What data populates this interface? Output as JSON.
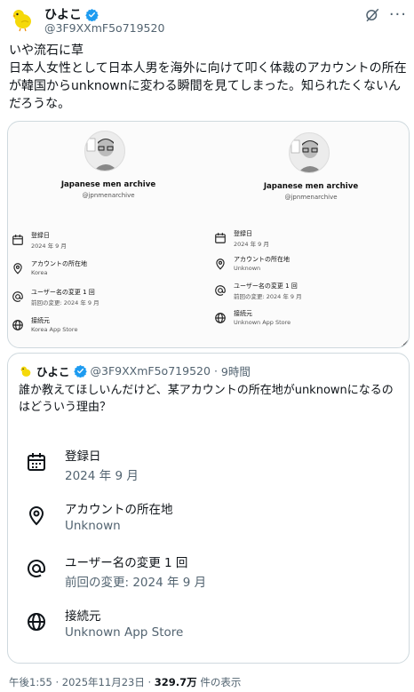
{
  "author": {
    "display_name": "ひよこ",
    "handle": "@3F9XXmF5o719520"
  },
  "tweet": {
    "text": "いや流石に草\n日本人女性として日本人男を海外に向けて叩く体裁のアカウントの所在が韓国からunknownに変わる瞬間を見てしまった。知られたくないんだろうな。"
  },
  "media": {
    "left": {
      "account_name": "Japanese men archive",
      "account_handle": "@jpnmenarchive",
      "rows": [
        {
          "label": "登録日",
          "value": "2024 年 9 月",
          "icon": "calendar-icon"
        },
        {
          "label": "アカウントの所在地",
          "value": "Korea",
          "icon": "location-icon"
        },
        {
          "label": "ユーザー名の変更 1 回",
          "value": "前回の変更: 2024 年 9 月",
          "icon": "at-icon"
        },
        {
          "label": "接続元",
          "value": "Korea App Store",
          "icon": "globe-icon"
        }
      ]
    },
    "right": {
      "account_name": "Japanese men archive",
      "account_handle": "@jpnmenarchive",
      "rows": [
        {
          "label": "登録日",
          "value": "2024 年 9 月",
          "icon": "calendar-icon"
        },
        {
          "label": "アカウントの所在地",
          "value": "Unknown",
          "icon": "location-icon"
        },
        {
          "label": "ユーザー名の変更 1 回",
          "value": "前回の変更: 2024 年 9 月",
          "icon": "at-icon"
        },
        {
          "label": "接続元",
          "value": "Unknown App Store",
          "icon": "globe-icon"
        }
      ]
    }
  },
  "quote": {
    "display_name": "ひよこ",
    "handle": "@3F9XXmF5o719520",
    "separator": "·",
    "time": "9時間",
    "text": "誰か教えてほしいんだけど、某アカウントの所在地がunknownになるのはどういう理由？",
    "rows": [
      {
        "label": "登録日",
        "value": "2024 年 9 月",
        "icon": "calendar-icon"
      },
      {
        "label": "アカウントの所在地",
        "value": "Unknown",
        "icon": "location-icon"
      },
      {
        "label": "ユーザー名の変更 1 回",
        "value": "前回の変更: 2024 年 9 月",
        "icon": "at-icon"
      },
      {
        "label": "接続元",
        "value": "Unknown App Store",
        "icon": "globe-icon"
      }
    ]
  },
  "footer": {
    "timestamp": "午後1:55 · 2025年11月23日 · ",
    "views_count": "329.7万",
    "views_suffix": " 件の表示"
  },
  "colors": {
    "verified": "#1d9bf0",
    "text": "#0f1419",
    "secondary": "#536471",
    "border": "#cfd9de"
  }
}
